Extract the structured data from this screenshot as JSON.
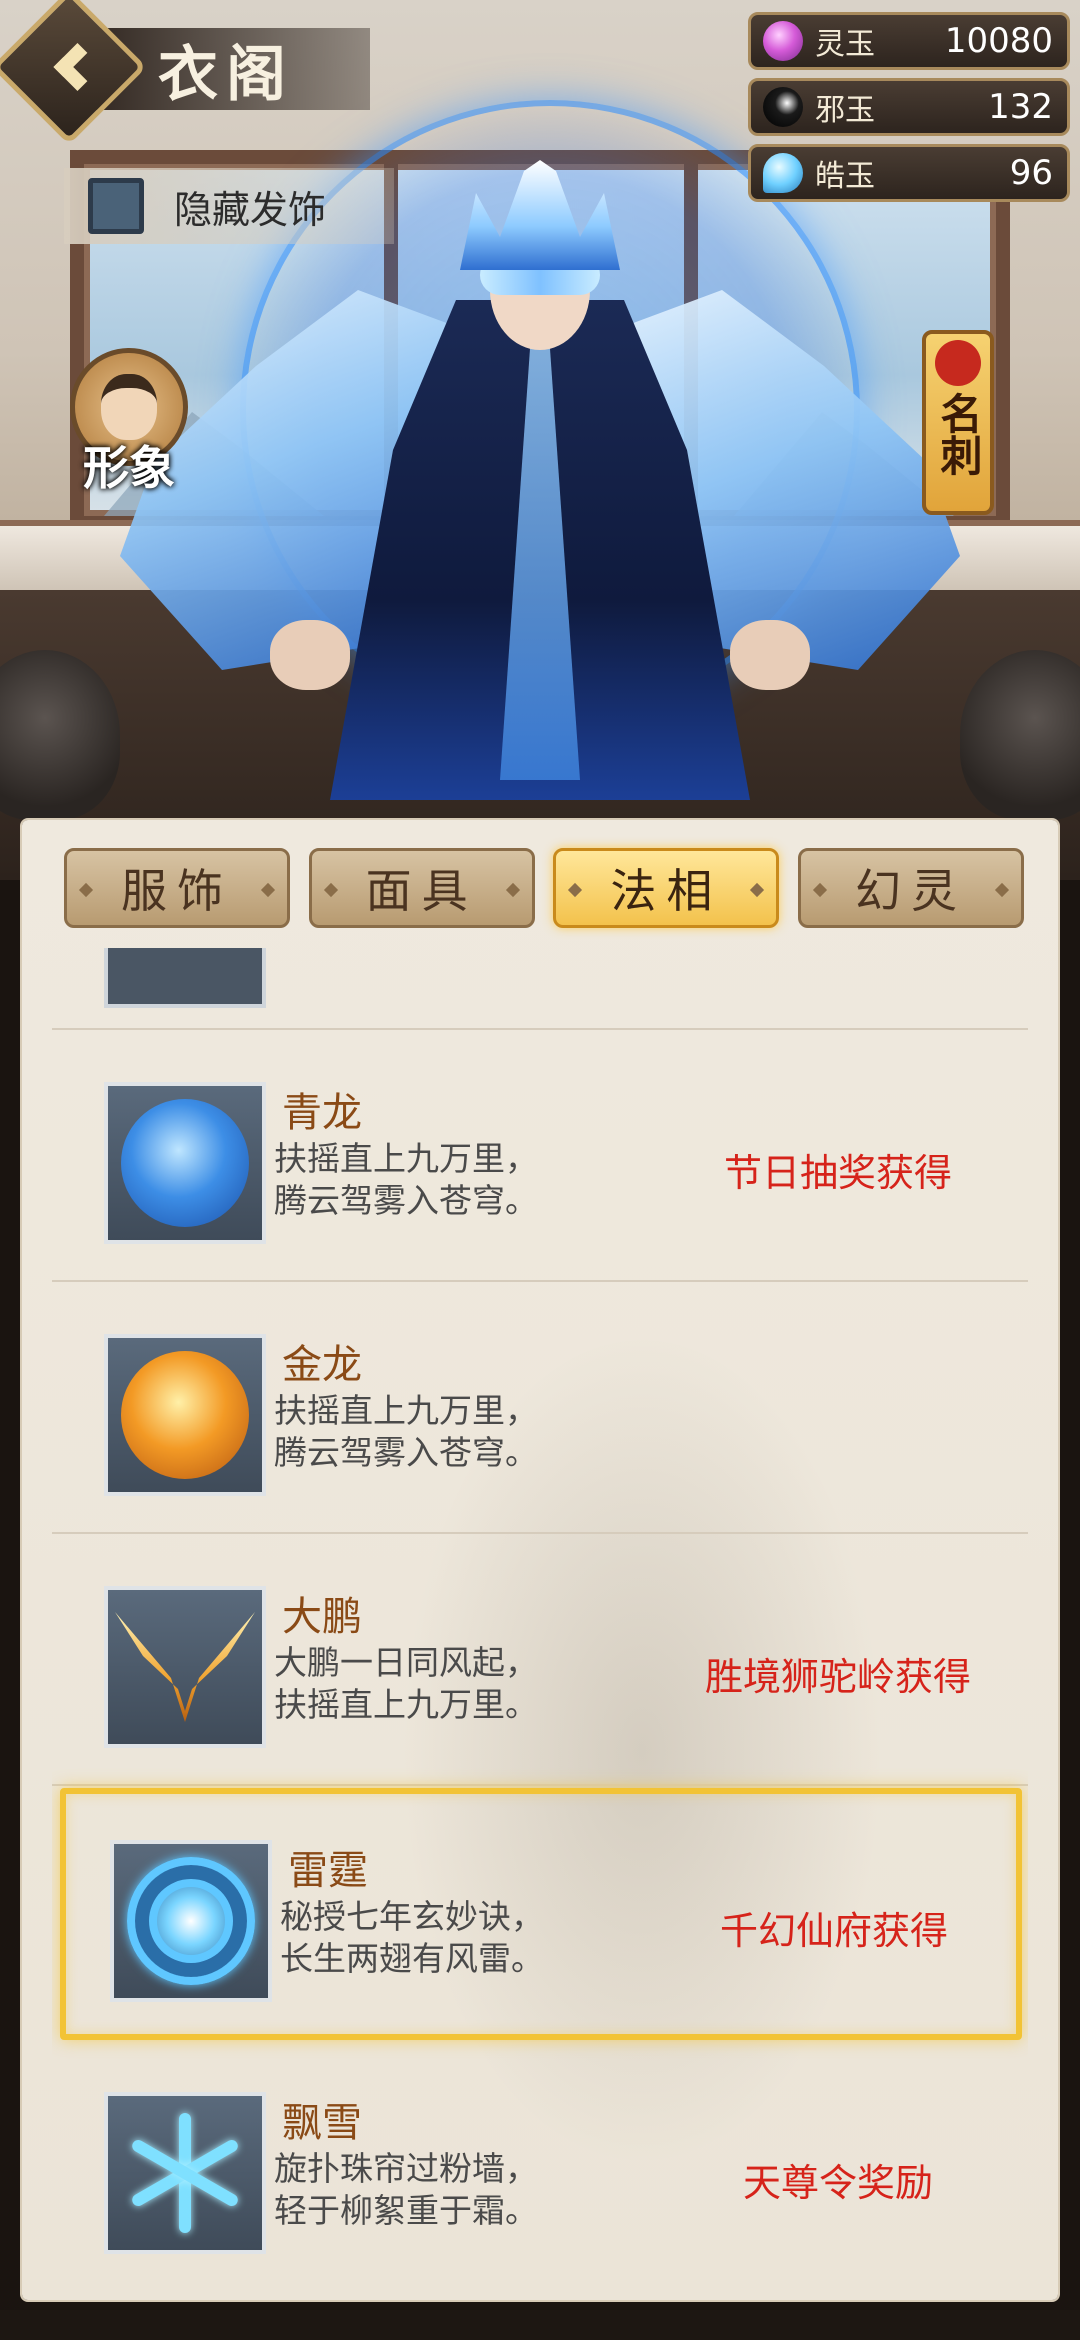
{
  "header": {
    "title": "衣阁",
    "back_icon": "chevron-left-icon"
  },
  "currencies": [
    {
      "name": "灵玉",
      "value": "10080",
      "icon": "pink-gem-icon",
      "color": "#d55bd8"
    },
    {
      "name": "邪玉",
      "value": "132",
      "icon": "dark-swirl-icon",
      "color": "#1a1a1a"
    },
    {
      "name": "皓玉",
      "value": "96",
      "icon": "blue-drop-icon",
      "color": "#6fd0ff"
    }
  ],
  "hide_accessory": {
    "label": "隐藏发饰",
    "checked": false
  },
  "side_buttons": {
    "appearance_label": "形象",
    "card_label": "名刺"
  },
  "tabs": [
    {
      "label": "服饰",
      "active": false
    },
    {
      "label": "面具",
      "active": false
    },
    {
      "label": "法相",
      "active": true
    },
    {
      "label": "幻灵",
      "active": false
    }
  ],
  "items": [
    {
      "name": "青龙",
      "desc_line1": "扶摇直上九万里，",
      "desc_line2": "腾云驾雾入苍穹。",
      "source": "节日抽奖获得",
      "icon": "blue-dragon-icon",
      "selected": false
    },
    {
      "name": "金龙",
      "desc_line1": "扶摇直上九万里，",
      "desc_line2": "腾云驾雾入苍穹。",
      "source": "",
      "icon": "gold-dragon-icon",
      "selected": false
    },
    {
      "name": "大鹏",
      "desc_line1": "大鹏一日同风起，",
      "desc_line2": "扶摇直上九万里。",
      "source": "胜境狮驼岭获得",
      "icon": "golden-wings-icon",
      "selected": false
    },
    {
      "name": "雷霆",
      "desc_line1": "秘授七年玄妙诀，",
      "desc_line2": "长生两翅有风雷。",
      "source": "千幻仙府获得",
      "icon": "thunder-circle-icon",
      "selected": true
    },
    {
      "name": "飘雪",
      "desc_line1": "旋扑珠帘过粉墙，",
      "desc_line2": "轻于柳絮重于霜。",
      "source": "天尊令奖励",
      "icon": "snowflake-icon",
      "selected": false
    }
  ],
  "colors": {
    "accent_gold": "#f3c24c",
    "source_red": "#d6231a",
    "name_brown": "#8a4a16"
  }
}
